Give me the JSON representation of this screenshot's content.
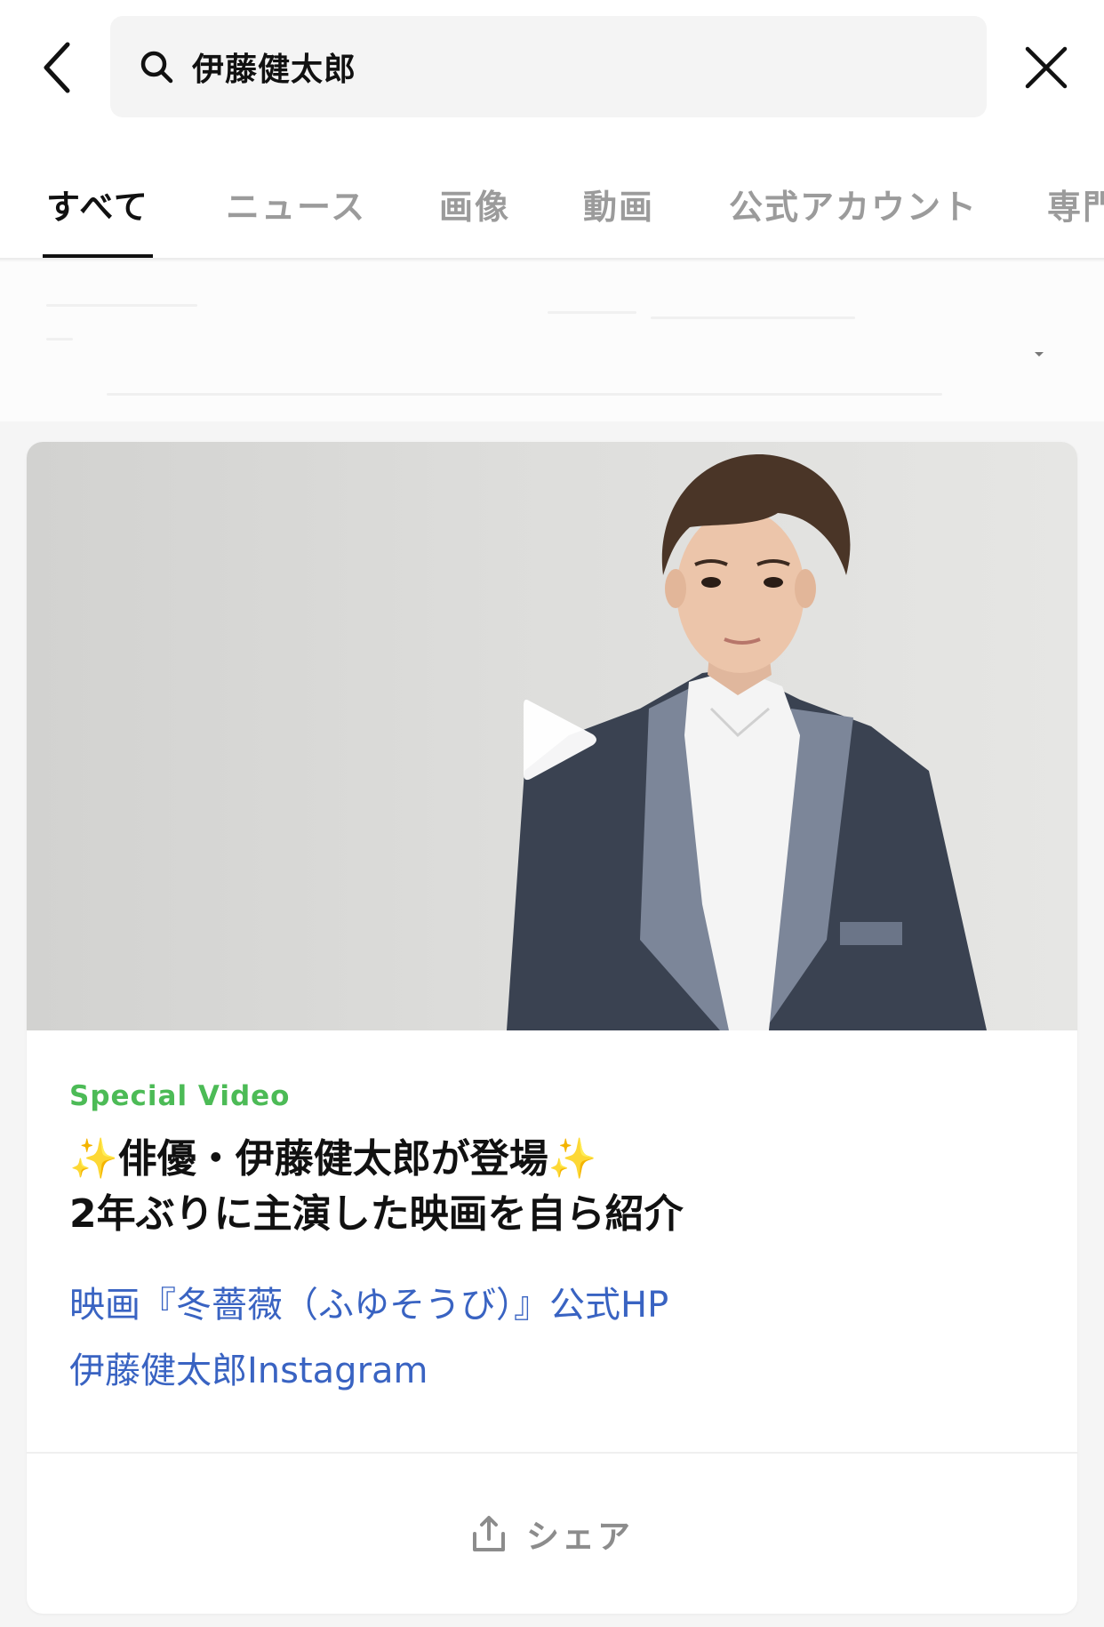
{
  "search": {
    "query": "伊藤健太郎"
  },
  "tabs": [
    {
      "label": "すべて",
      "active": true
    },
    {
      "label": "ニュース",
      "active": false
    },
    {
      "label": "画像",
      "active": false
    },
    {
      "label": "動画",
      "active": false
    },
    {
      "label": "公式アカウント",
      "active": false
    },
    {
      "label": "専門",
      "active": false
    }
  ],
  "card": {
    "category": "Special Video",
    "category_color": "#4cbb56",
    "headline": {
      "line1_prefix_emoji": "✨",
      "line1_text": "俳優・伊藤健太郎が登場",
      "line1_suffix_emoji": "✨",
      "line2": "2年ぶりに主演した映画を自ら紹介"
    },
    "links": [
      "映画『冬薔薇（ふゆそうび）』公式HP",
      "伊藤健太郎Instagram"
    ],
    "link_color": "#3963c2",
    "share_label": "シェア"
  },
  "icons": {
    "back": "chevron-left-icon",
    "search": "search-icon",
    "close": "close-icon",
    "play": "play-icon",
    "share": "share-icon"
  }
}
